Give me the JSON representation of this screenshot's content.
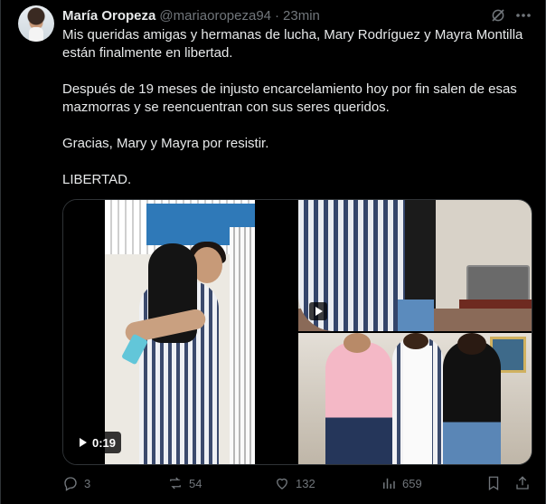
{
  "author": {
    "name": "María Oropeza",
    "handle": "@mariaoropeza94",
    "separator": "·",
    "time": "23min"
  },
  "text": {
    "p1": "Mis queridas amigas y hermanas de lucha, Mary Rodríguez y Mayra Montilla están finalmente en libertad.",
    "p2": "Después de 19 meses de injusto encarcelamiento hoy por fin salen de esas mazmorras y se reencuentran con sus seres queridos.",
    "p3": "Gracias, Mary y Mayra por resistir.",
    "p4": "LIBERTAD."
  },
  "media": {
    "video_duration": "0:19"
  },
  "actions": {
    "replies": "3",
    "reposts": "54",
    "likes": "132",
    "views": "659"
  },
  "icons": [
    "grok-icon",
    "more-icon",
    "reply-icon",
    "repost-icon",
    "like-icon",
    "views-icon",
    "bookmark-icon",
    "share-icon",
    "play-icon"
  ]
}
